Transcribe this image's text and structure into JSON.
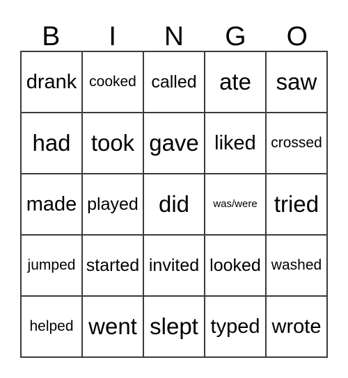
{
  "card": {
    "headers": [
      "B",
      "I",
      "N",
      "G",
      "O"
    ],
    "rows": [
      {
        "cells": [
          {
            "text": "drank",
            "size": "lg"
          },
          {
            "text": "cooked",
            "size": "sm"
          },
          {
            "text": "called",
            "size": "md"
          },
          {
            "text": "ate",
            "size": "xl"
          },
          {
            "text": "saw",
            "size": "xl"
          }
        ]
      },
      {
        "cells": [
          {
            "text": "had",
            "size": "xl"
          },
          {
            "text": "took",
            "size": "xl"
          },
          {
            "text": "gave",
            "size": "xl"
          },
          {
            "text": "liked",
            "size": "lg"
          },
          {
            "text": "crossed",
            "size": "sm"
          }
        ]
      },
      {
        "cells": [
          {
            "text": "made",
            "size": "lg"
          },
          {
            "text": "played",
            "size": "md"
          },
          {
            "text": "did",
            "size": "xl"
          },
          {
            "text": "was/were",
            "size": "xs"
          },
          {
            "text": "tried",
            "size": "xl"
          }
        ]
      },
      {
        "cells": [
          {
            "text": "jumped",
            "size": "sm"
          },
          {
            "text": "started",
            "size": "md"
          },
          {
            "text": "invited",
            "size": "md"
          },
          {
            "text": "looked",
            "size": "md"
          },
          {
            "text": "washed",
            "size": "sm"
          }
        ]
      },
      {
        "cells": [
          {
            "text": "helped",
            "size": "sm"
          },
          {
            "text": "went",
            "size": "xl"
          },
          {
            "text": "slept",
            "size": "xl"
          },
          {
            "text": "typed",
            "size": "lg"
          },
          {
            "text": "wrote",
            "size": "lg"
          }
        ]
      }
    ]
  },
  "colors": {
    "grid_line": "#3a3a3a",
    "text": "#000000",
    "background": "#ffffff"
  }
}
